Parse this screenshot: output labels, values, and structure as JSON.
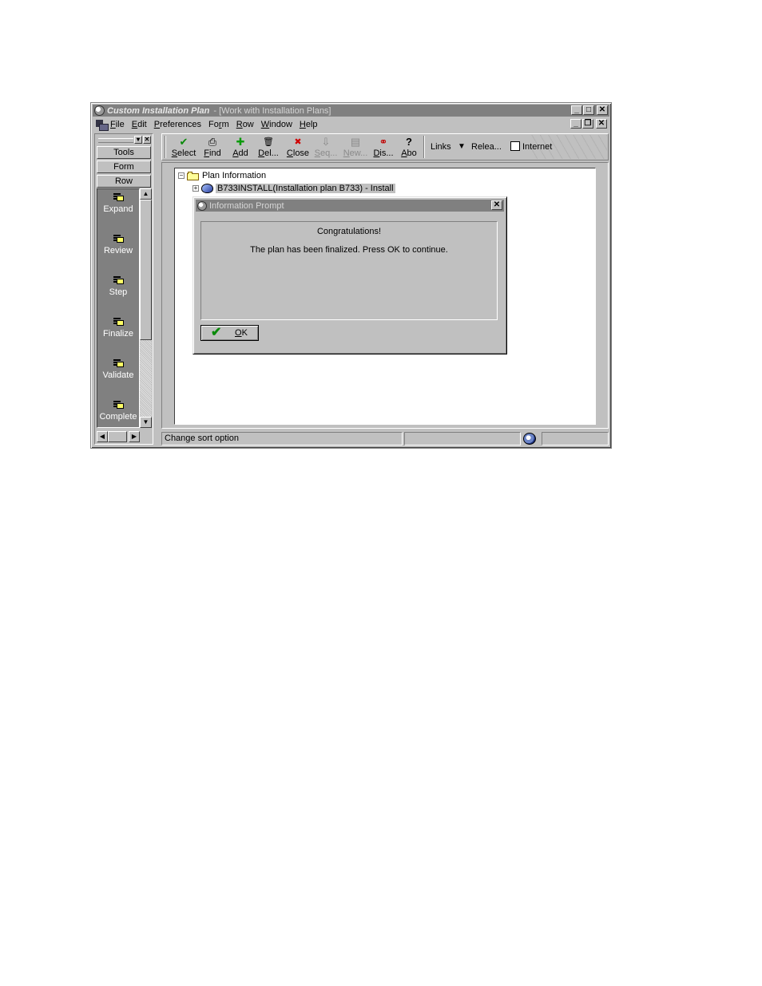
{
  "window": {
    "app_title": "Custom Installation Plan",
    "form_title": " - [Work with Installation Plans]",
    "min_glyph": "_",
    "max_glyph": "□",
    "close_glyph": "✕",
    "restore_glyph": "❐"
  },
  "menu": {
    "items": [
      {
        "accel": "F",
        "rest": "ile"
      },
      {
        "accel": "E",
        "rest": "dit"
      },
      {
        "accel": "P",
        "rest": "references"
      },
      {
        "pre": "Fo",
        "accel": "r",
        "rest": "m"
      },
      {
        "accel": "R",
        "rest": "ow"
      },
      {
        "accel": "W",
        "rest": "indow"
      },
      {
        "accel": "H",
        "rest": "elp"
      }
    ]
  },
  "left_panel": {
    "tabs": [
      "Tools",
      "Form",
      "Row"
    ],
    "row_items": [
      "Expand",
      "Review",
      "Step",
      "Finalize",
      "Validate",
      "Complete"
    ]
  },
  "toolbar": {
    "buttons": [
      {
        "accel": "S",
        "rest": "elect",
        "icon": "checkmark-icon",
        "glyph": "✔",
        "color": "#0a8a0a"
      },
      {
        "accel": "F",
        "rest": "ind",
        "icon": "find-icon",
        "glyph": "⎙",
        "color": "#000000"
      },
      {
        "accel": "A",
        "rest": "dd",
        "icon": "add-icon",
        "glyph": "✚",
        "color": "#0a9a0a"
      },
      {
        "accel": "D",
        "rest": "el...",
        "icon": "trash-icon",
        "glyph": "🗑",
        "color": "#000000"
      },
      {
        "accel": "C",
        "rest": "lose",
        "icon": "close-x-icon",
        "glyph": "✖",
        "color": "#d00000"
      },
      {
        "accel": "S",
        "rest": "eq...",
        "icon": "sequence-icon",
        "glyph": "⇩",
        "color": "#8a8a8a",
        "disabled": true
      },
      {
        "accel": "N",
        "rest": "ew...",
        "icon": "new-icon",
        "glyph": "▤",
        "color": "#8a8a8a",
        "disabled": true
      },
      {
        "accel": "D",
        "rest": "is...",
        "icon": "display-icon",
        "glyph": "⚭",
        "color": "#000000"
      },
      {
        "accel": "A",
        "rest": "bo",
        "icon": "about-help-icon",
        "glyph": "?",
        "color": "#000000"
      }
    ],
    "links_label": "Links",
    "release_label": "Relea...",
    "internet_label": "Internet"
  },
  "tree": {
    "root_label": "Plan Information",
    "child_label": "B733INSTALL(Installation plan B733) - Install"
  },
  "dialog": {
    "title": "Information Prompt",
    "line1": "Congratulations!",
    "line2": "The plan has been finalized.  Press OK to continue.",
    "ok_accel": "O",
    "ok_rest": "K"
  },
  "status": {
    "text": "Change sort option"
  }
}
